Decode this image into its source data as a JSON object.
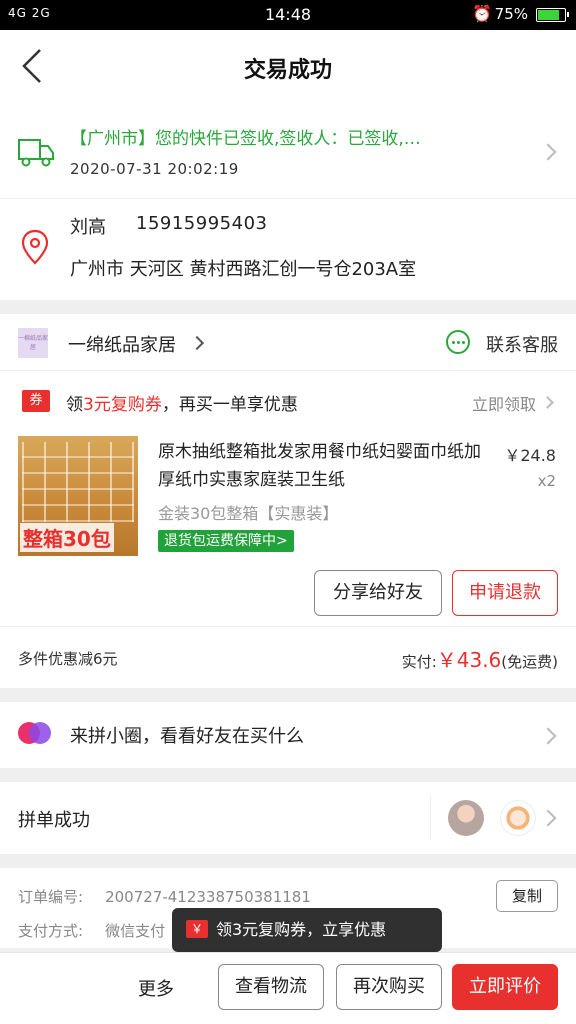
{
  "status_bar": {
    "network": "4G 2G",
    "time": "14:48",
    "battery": "75%"
  },
  "nav": {
    "title": "交易成功"
  },
  "logistics": {
    "status": "【广州市】您的快件已签收,签收人：已签收,…",
    "time": "2020-07-31 20:02:19"
  },
  "address": {
    "name": "刘高",
    "phone": "15915995403",
    "detail": "广州市 天河区 黄村西路汇创一号仓203A室"
  },
  "shop": {
    "logo_text": "一棉纸品家居",
    "name": "一绵纸品家居",
    "contact_label": "联系客服"
  },
  "coupon": {
    "badge": "券",
    "text_prefix": "领",
    "text_highlight": "3元复购券",
    "text_suffix": "，再买一单享优惠",
    "action": "立即领取"
  },
  "product": {
    "image_promo": "整箱30包",
    "title": "原木抽纸整箱批发家用餐巾纸妇婴面巾纸加厚纸巾实惠家庭装卫生纸",
    "price": "￥24.8",
    "qty": "x2",
    "spec": "金装30包整箱【实惠装】",
    "tag": "退货包运费保障中>"
  },
  "actions": {
    "share": "分享给好友",
    "refund": "申请退款"
  },
  "summary": {
    "discount": "多件优惠减6元",
    "paid_label": "实付:",
    "paid_amount": "￥43.6",
    "paid_note": "(免运费)"
  },
  "circle": {
    "label": "来拼小圈，看看好友在买什么"
  },
  "group": {
    "label": "拼单成功"
  },
  "order": {
    "id_label": "订单编号:",
    "id_value": "200727-412338750381181",
    "pay_label": "支付方式:",
    "pay_value": "微信支付",
    "copy_label": "复制"
  },
  "tooltip": {
    "icon": "￥",
    "text": "领3元复购券，立享优惠"
  },
  "bottom": {
    "more": "更多",
    "track": "查看物流",
    "rebuy": "再次购买",
    "review": "立即评价"
  },
  "colors": {
    "accent_red": "#e8302e",
    "success_green": "#2aa73a"
  },
  "icons": [
    "back-arrow-icon",
    "truck-icon",
    "location-pin-icon",
    "chat-icon",
    "chevron-right-icon",
    "circle-logo-icon"
  ]
}
